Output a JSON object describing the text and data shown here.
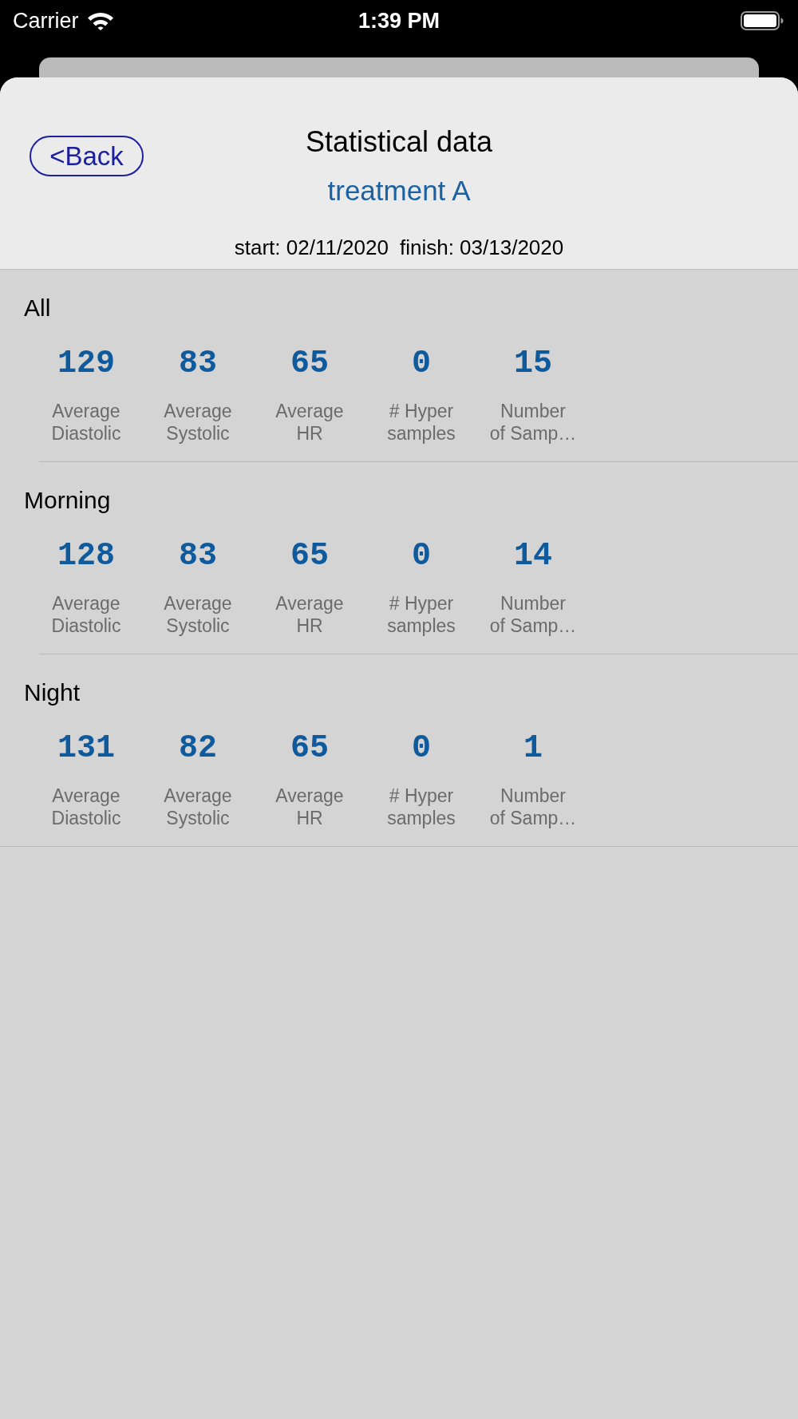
{
  "status_bar": {
    "carrier": "Carrier",
    "time": "1:39 PM"
  },
  "header": {
    "back_button": "<Back",
    "title": "Statistical data",
    "subtitle": "treatment A",
    "start": "start: 02/11/2020",
    "finish": "finish: 03/13/2020"
  },
  "sections": [
    {
      "title": "All",
      "stats": [
        {
          "value": "129",
          "label": "Average\nDiastolic"
        },
        {
          "value": "83",
          "label": "Average\nSystolic"
        },
        {
          "value": "65",
          "label": "Average\nHR"
        },
        {
          "value": "0",
          "label": "# Hyper\nsamples"
        },
        {
          "value": "15",
          "label": "Number\nof Samp…"
        }
      ]
    },
    {
      "title": "Morning",
      "stats": [
        {
          "value": "128",
          "label": "Average\nDiastolic"
        },
        {
          "value": "83",
          "label": "Average\nSystolic"
        },
        {
          "value": "65",
          "label": "Average\nHR"
        },
        {
          "value": "0",
          "label": "# Hyper\nsamples"
        },
        {
          "value": "14",
          "label": "Number\nof Samp…"
        }
      ]
    },
    {
      "title": "Night",
      "stats": [
        {
          "value": "131",
          "label": "Average\nDiastolic"
        },
        {
          "value": "82",
          "label": "Average\nSystolic"
        },
        {
          "value": "65",
          "label": "Average\nHR"
        },
        {
          "value": "0",
          "label": "# Hyper\nsamples"
        },
        {
          "value": "1",
          "label": "Number\nof Samp…"
        }
      ]
    }
  ]
}
